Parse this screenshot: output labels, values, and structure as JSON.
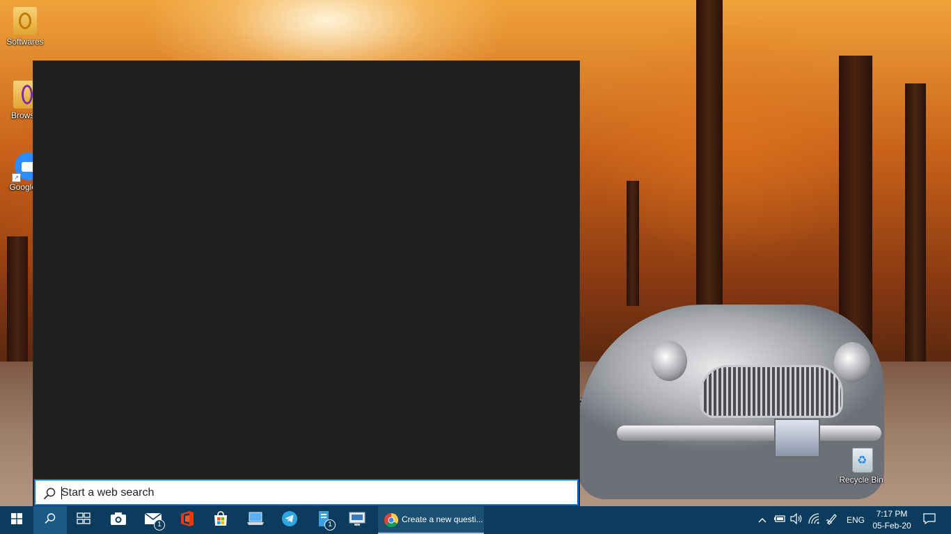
{
  "desktop": {
    "icons": [
      {
        "label": "Softwares",
        "icon": "folder-app-icon"
      },
      {
        "label": "Browse",
        "icon": "folder-browser-icon"
      },
      {
        "label": "Google I",
        "icon": "zoom-shortcut-icon"
      },
      {
        "label": "Recycle Bin",
        "icon": "recycle-bin-icon"
      }
    ]
  },
  "search": {
    "placeholder": "Start a web search",
    "value": ""
  },
  "taskbar": {
    "start_icon": "windows-logo-icon",
    "search_icon": "search-icon",
    "task_view_icon": "task-view-icon",
    "pinned": [
      {
        "name": "camera",
        "icon": "camera-icon"
      },
      {
        "name": "mail",
        "icon": "mail-icon",
        "badge": "1"
      },
      {
        "name": "office",
        "icon": "office-icon"
      },
      {
        "name": "store",
        "icon": "store-icon"
      },
      {
        "name": "pc",
        "icon": "computer-icon"
      },
      {
        "name": "telegram",
        "icon": "telegram-icon"
      },
      {
        "name": "files",
        "icon": "files-icon",
        "badge": "1"
      },
      {
        "name": "remote",
        "icon": "remote-desktop-icon"
      }
    ],
    "active_window": {
      "icon": "chrome-icon",
      "title": "Create a new questi..."
    },
    "tray": {
      "language": "ENG",
      "time": "7:17 PM",
      "date": "05-Feb-20"
    }
  },
  "colors": {
    "taskbar": "#0b3c5d",
    "flyout": "#1f1f1f",
    "accent": "#0078d7"
  }
}
